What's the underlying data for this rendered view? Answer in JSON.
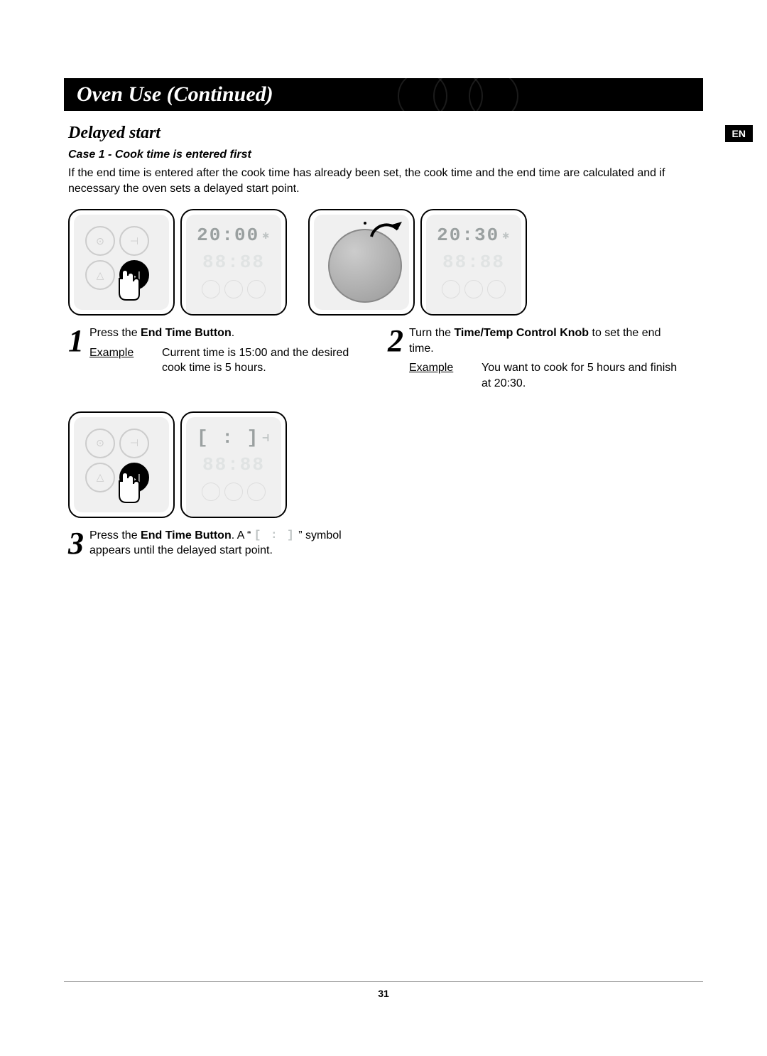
{
  "header": {
    "title": "Oven Use (Continued)"
  },
  "lang_tab": "EN",
  "subheading": "Delayed start",
  "case_title": "Case 1 - Cook time is entered first",
  "intro": "If the end time is entered after the cook time has already been set, the cook time and the end time are calculated and if necessary the oven sets a delayed start point.",
  "displays": {
    "panel1_time": "20:00",
    "panel1_dim": "88:88",
    "panel2_time": "20:30",
    "panel2_dim": "88:88",
    "panel3_blank": "[ : ]",
    "panel3_dim": "88:88",
    "inline_blank": "[ : ]"
  },
  "steps": {
    "s1": {
      "num": "1",
      "text_a": "Press the ",
      "text_b_bold": "End Time Button",
      "text_c": ".",
      "example_label": "Example",
      "example_text": "Current time is 15:00 and the desired cook time is 5 hours."
    },
    "s2": {
      "num": "2",
      "text_a": "Turn the ",
      "text_b_bold": "Time/Temp Control Knob",
      "text_c": " to set the end time.",
      "example_label": "Example",
      "example_text": "You want to cook for 5 hours and finish at 20:30."
    },
    "s3": {
      "num": "3",
      "text_a": "Press the ",
      "text_b_bold": "End Time Button",
      "text_c": ". A “ ",
      "text_d": " ” symbol appears until the delayed start point."
    }
  },
  "page_number": "31"
}
